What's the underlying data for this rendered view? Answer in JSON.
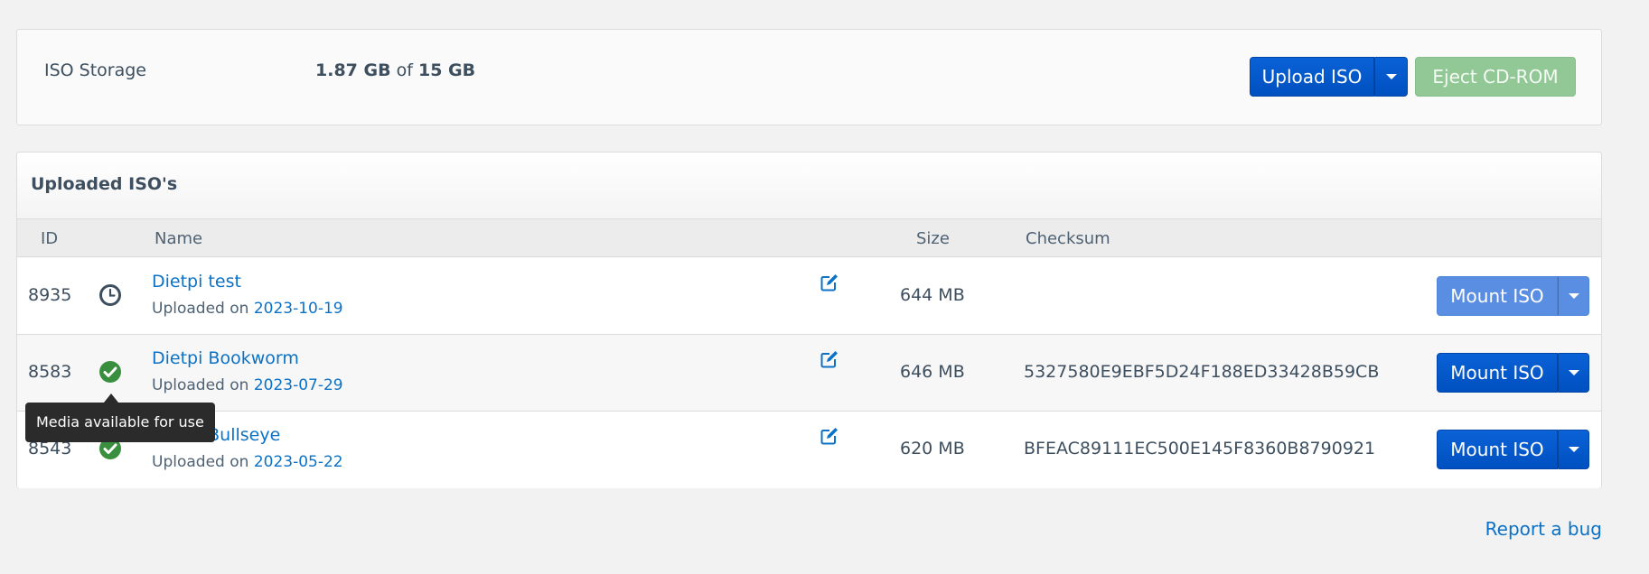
{
  "storage": {
    "label": "ISO Storage",
    "used": "1.87 GB",
    "of_text": "of",
    "total": "15 GB",
    "upload_button": "Upload ISO",
    "eject_button": "Eject CD-ROM"
  },
  "iso_panel": {
    "title": "Uploaded ISO's",
    "columns": {
      "id": "ID",
      "name": "Name",
      "size": "Size",
      "checksum": "Checksum"
    },
    "uploaded_prefix": "Uploaded on",
    "rows": [
      {
        "id": "8935",
        "status_icon": "clock-icon",
        "name": "Dietpi test",
        "date": "2023-10-19",
        "size": "644 MB",
        "checksum": "",
        "mount_label": "Mount ISO",
        "mount_enabled": false
      },
      {
        "id": "8583",
        "status_icon": "check-circle-icon",
        "name": "Dietpi Bookworm",
        "date": "2023-07-29",
        "size": "646 MB",
        "checksum": "5327580E9EBF5D24F188ED33428B59CB",
        "mount_label": "Mount ISO",
        "mount_enabled": true
      },
      {
        "id": "8543",
        "status_icon": "check-circle-icon",
        "name": "DietPI Bullseye",
        "date": "2023-05-22",
        "size": "620 MB",
        "checksum": "BFEAC89111EC500E145F8360B8790921",
        "mount_label": "Mount ISO",
        "mount_enabled": true
      }
    ]
  },
  "tooltip": {
    "text": "Media available for use"
  },
  "footer": {
    "report_bug": "Report a bug"
  },
  "colors": {
    "primary_button": "#0050c0",
    "disabled_button": "#5a8ee3",
    "eject_button": "#92c796",
    "link": "#0b72c7",
    "status_ok": "#3a8f3e",
    "status_pending": "#3d4f5f"
  }
}
